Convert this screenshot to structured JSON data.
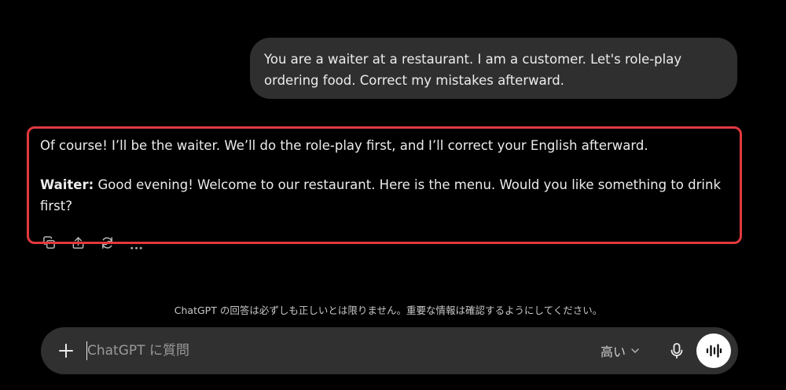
{
  "conversation": {
    "user_message": "You are a waiter at a restaurant. I am a customer. Let's role-play ordering food. Correct my mistakes afterward.",
    "assistant": {
      "intro": "Of course! I’ll be the waiter. We’ll do the role-play first, and I’ll correct your English afterward.",
      "speaker": "Waiter:",
      "line": " Good evening! Welcome to our restaurant. Here is the menu. Would you like something to drink first?"
    },
    "actions": [
      "copy-icon",
      "share-icon",
      "regenerate-icon",
      "more-icon"
    ]
  },
  "disclaimer": "ChatGPT の回答は必ずしも正しいとは限りません。重要な情報は確認するようにしてください。",
  "composer": {
    "placeholder": "ChatGPT に質問",
    "model_label": "高い"
  },
  "colors": {
    "background": "#000000",
    "user_bubble": "#2f2f2f",
    "composer": "#303030",
    "highlight": "#e0393e"
  }
}
